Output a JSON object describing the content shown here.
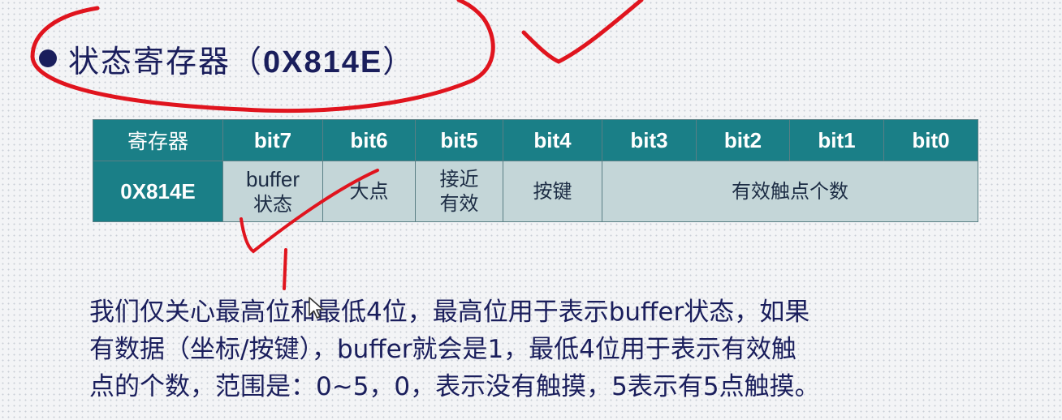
{
  "heading": {
    "text": "状态寄存器（",
    "code": "0X814E",
    "close": "）"
  },
  "table": {
    "headers": [
      "寄存器",
      "bit7",
      "bit6",
      "bit5",
      "bit4",
      "bit3",
      "bit2",
      "bit1",
      "bit0"
    ],
    "row": {
      "address": "0X814E",
      "bit7": [
        "buffer",
        "状态"
      ],
      "bit6": "大点",
      "bit5": [
        "接近",
        "有效"
      ],
      "bit4": "按键",
      "bit3_0": "有效触点个数"
    }
  },
  "description": {
    "lines": [
      "我们仅关心最高位和最低4位，最高位用于表示buffer状态，如果",
      "有数据（坐标/按键），buffer就会是1，最低4位用于表示有效触",
      "点的个数，范围是：0~5，0，表示没有触摸，5表示有5点触摸。"
    ]
  },
  "annotation": {
    "ink_color": "#e0141e"
  },
  "colors": {
    "header_bg": "#1a7f87",
    "cell_bg": "#c4d6d8",
    "text": "#1a1e5c"
  }
}
